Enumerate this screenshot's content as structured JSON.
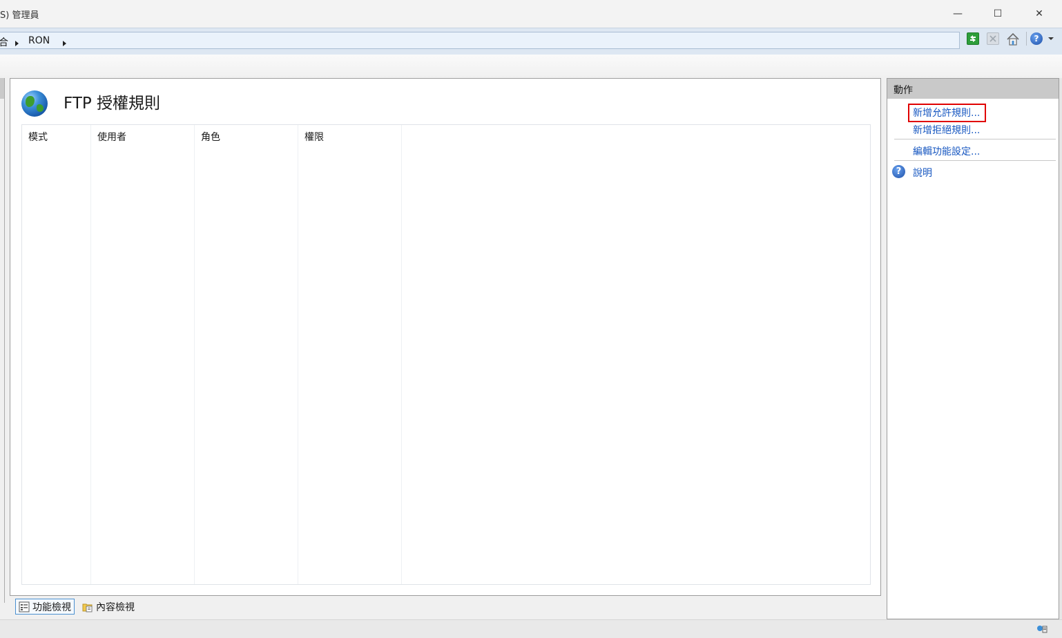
{
  "window": {
    "title": "S) 管理員",
    "minimize_glyph": "—",
    "maximize_glyph": "☐",
    "close_glyph": "✕"
  },
  "address_bar": {
    "crumbs": [
      "合",
      "RON"
    ]
  },
  "toolbar": {
    "icons": [
      "refresh-icon",
      "stop-icon",
      "home-icon",
      "help-icon"
    ]
  },
  "main": {
    "title": "FTP 授權規則",
    "columns": [
      "模式",
      "使用者",
      "角色",
      "權限"
    ],
    "rows": []
  },
  "view_bar": {
    "features_view": "功能檢視",
    "content_view": "內容檢視"
  },
  "actions": {
    "header": "動作",
    "items": [
      {
        "label": "新增允許規則..."
      },
      {
        "label": "新增拒絕規則..."
      },
      {
        "label": "編輯功能設定..."
      },
      {
        "label": "說明"
      }
    ]
  },
  "colors": {
    "link": "#1757c1",
    "highlight_box": "#e00000",
    "address_bar_bg": "#dde7f2"
  }
}
